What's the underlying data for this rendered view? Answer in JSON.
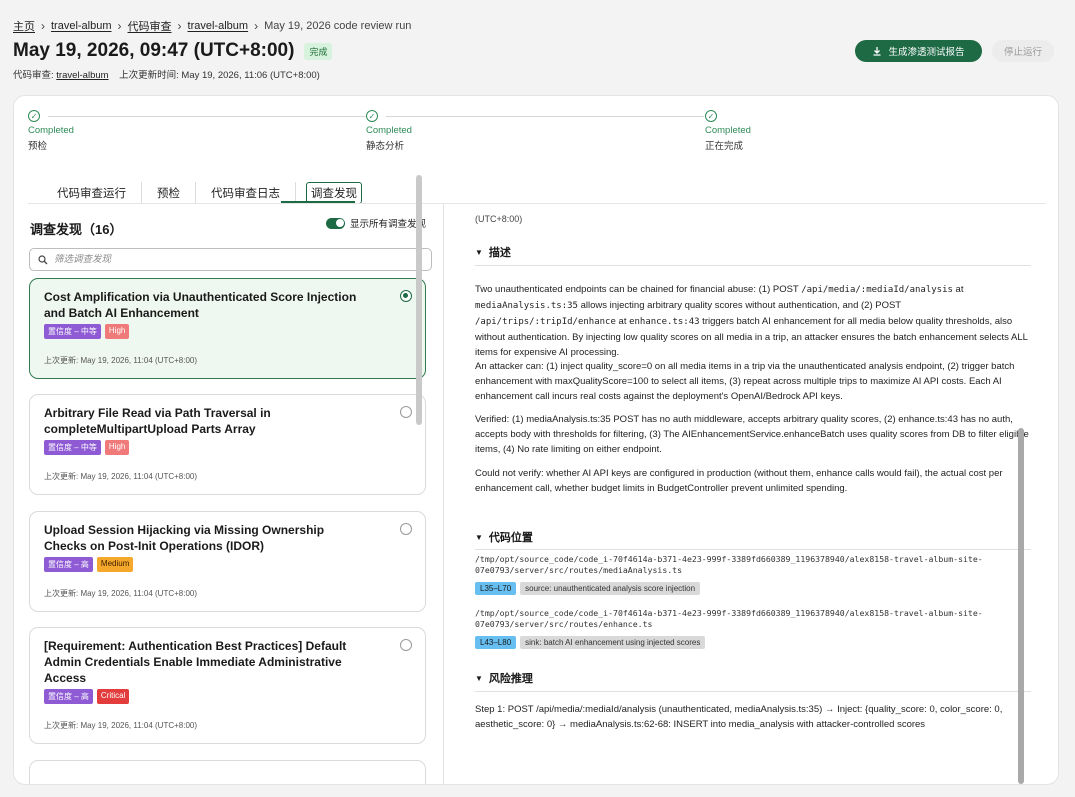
{
  "breadcrumb": {
    "home": "主页",
    "project": "travel-album",
    "section": "代码审查",
    "repo": "travel-album",
    "current": "May 19, 2026 code review run"
  },
  "header": {
    "title": "May 19, 2026, 09:47 (UTC+8:00)",
    "status": "完成",
    "meta_label": "代码审查:",
    "meta_link": "travel-album",
    "meta_updated": "上次更新时间: May 19, 2026, 11:06 (UTC+8:00)",
    "report_button": "生成渗透测试报告",
    "stop_button": "停止运行"
  },
  "steps": [
    {
      "status": "Completed",
      "label": "预检"
    },
    {
      "status": "Completed",
      "label": "静态分析"
    },
    {
      "status": "Completed",
      "label": "正在完成"
    }
  ],
  "tabs": [
    "代码审查运行",
    "预检",
    "代码审查日志",
    "调查发现"
  ],
  "findings_panel": {
    "title": "调查发现（16）",
    "toggle_label": "显示所有调查发现",
    "search_placeholder": "筛选调查发现"
  },
  "findings": [
    {
      "title": "Cost Amplification via Unauthenticated Score Injection and Batch AI Enhancement",
      "confidence": "置信度 – 中等",
      "severity": "High",
      "updated": "上次更新: May 19, 2026, 11:04 (UTC+8:00)"
    },
    {
      "title": "Arbitrary File Read via Path Traversal in completeMultipartUpload Parts Array",
      "confidence": "置信度 – 中等",
      "severity": "High",
      "updated": "上次更新: May 19, 2026, 11:04 (UTC+8:00)"
    },
    {
      "title": "Upload Session Hijacking via Missing Ownership Checks on Post-Init Operations (IDOR)",
      "confidence": "置信度 – 高",
      "severity": "Medium",
      "updated": "上次更新: May 19, 2026, 11:04 (UTC+8:00)"
    },
    {
      "title": "[Requirement: Authentication Best Practices] Default Admin Credentials Enable Immediate Administrative Access",
      "confidence": "置信度 – 高",
      "severity": "Critical",
      "updated": "上次更新: May 19, 2026, 11:04 (UTC+8:00)"
    }
  ],
  "detail": {
    "cut_top": "(UTC+8:00)",
    "desc_heading": "描述",
    "desc_p1_a": "Two unauthenticated endpoints can be chained for financial abuse: (1) POST ",
    "desc_p1_code1": "/api/media/:mediaId/analysis",
    "desc_p1_b": " at ",
    "desc_p1_code2": "mediaAnalysis.ts:35",
    "desc_p1_c": " allows injecting arbitrary quality scores without authentication, and (2) POST ",
    "desc_p1_code3": "/api/trips/:tripId/enhance",
    "desc_p1_d": " at ",
    "desc_p1_code4": "enhance.ts:43",
    "desc_p1_e": " triggers batch AI enhancement for all media below quality thresholds, also without authentication. By injecting low quality scores on all media in a trip, an attacker ensures the batch enhancement selects ALL items for expensive AI processing.",
    "desc_p2": "An attacker can: (1) inject quality_score=0 on all media items in a trip via the unauthenticated analysis endpoint, (2) trigger batch enhancement with maxQualityScore=100 to select all items, (3) repeat across multiple trips to maximize AI API costs. Each AI enhancement call incurs real costs against the deployment's OpenAI/Bedrock API keys.",
    "desc_p3": "Verified: (1) mediaAnalysis.ts:35 POST has no auth middleware, accepts arbitrary quality scores, (2) enhance.ts:43 has no auth, accepts body with thresholds for filtering, (3) The AIEnhancementService.enhanceBatch uses quality scores from DB to filter eligible items, (4) No rate limiting on either endpoint.",
    "desc_p4": "Could not verify: whether AI API keys are configured in production (without them, enhance calls would fail), the actual cost per enhancement call, whether budget limits in BudgetController prevent unlimited spending.",
    "loc_heading": "代码位置",
    "loc1_path": "/tmp/opt/source_code/code_i-70f4614a-b371-4e23-999f-3389fd660389_1196378940/alex8158-travel-album-site-07e0793/server/src/routes/mediaAnalysis.ts",
    "loc1_range": "L35–L70",
    "loc1_note": "source: unauthenticated analysis score injection",
    "loc2_path": "/tmp/opt/source_code/code_i-70f4614a-b371-4e23-999f-3389fd660389_1196378940/alex8158-travel-album-site-07e0793/server/src/routes/enhance.ts",
    "loc2_range": "L43–L80",
    "loc2_note": "sink: batch AI enhancement using injected scores",
    "risk_heading": "风险推理",
    "risk_p1": "Step 1: POST /api/media/:mediaId/analysis (unauthenticated, mediaAnalysis.ts:35) → Inject: {quality_score: 0, color_score: 0, aesthetic_score: 0} → mediaAnalysis.ts:62-68: INSERT into media_analysis with attacker-controlled scores"
  }
}
